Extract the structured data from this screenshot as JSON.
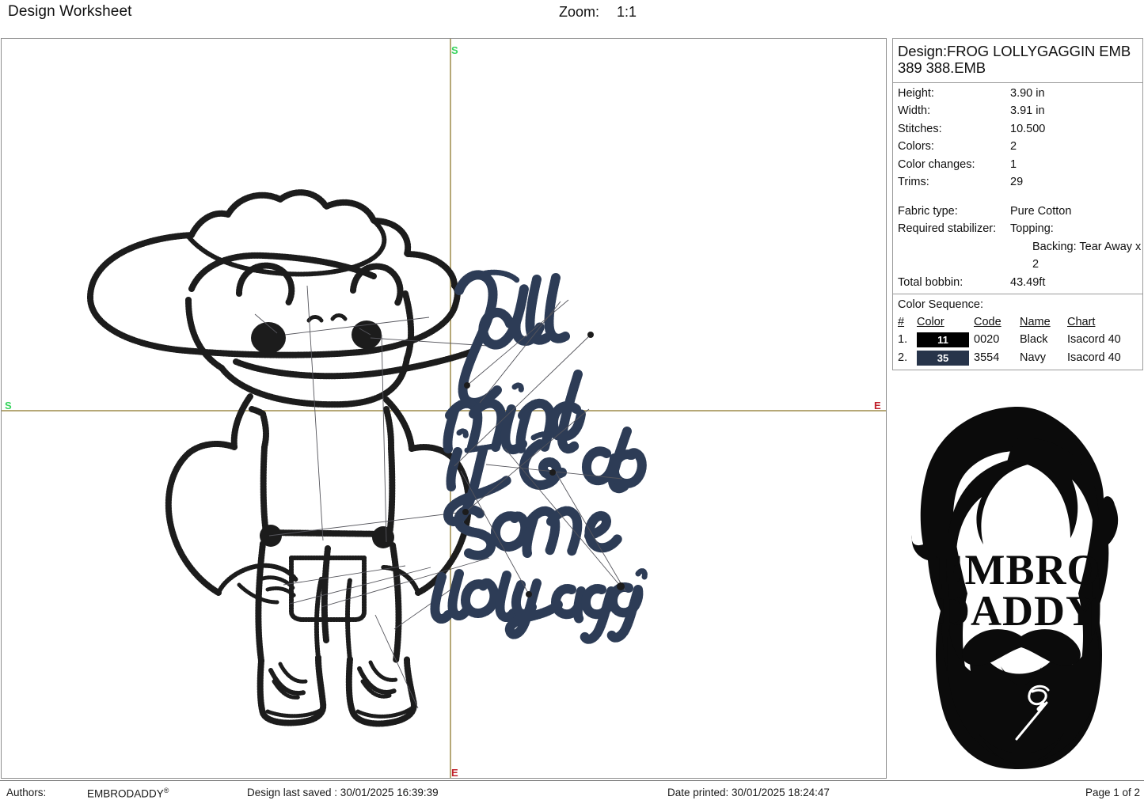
{
  "header": {
    "title": "Design Worksheet",
    "zoom_label": "Zoom:",
    "zoom_value": "1:1"
  },
  "canvas": {
    "axis_markers": {
      "left": "S",
      "right": "E",
      "top": "S",
      "bottom": "E"
    },
    "design_text_lines": [
      "Y'all",
      "mind",
      "if I do",
      "some",
      "lollygaggin'"
    ],
    "artwork_description": "Cowboy frog wearing hat, overalls and boots",
    "colors": {
      "axis_line": "#b6a877",
      "start_marker": "#35d35c",
      "end_marker": "#c0202a",
      "outline_black": "#1c1c1c",
      "script_navy": "#2d3c56"
    }
  },
  "info": {
    "design_title": "Design:FROG LOLLYGAGGIN EMB 389 388.EMB",
    "properties": [
      {
        "label": "Height:",
        "value": "3.90 in"
      },
      {
        "label": "Width:",
        "value": "3.91 in"
      },
      {
        "label": "Stitches:",
        "value": "10.500"
      },
      {
        "label": "Colors:",
        "value": "2"
      },
      {
        "label": "Color changes:",
        "value": "1"
      },
      {
        "label": "Trims:",
        "value": "29"
      }
    ],
    "fabric": [
      {
        "label": "Fabric type:",
        "value": "Pure Cotton"
      },
      {
        "label": "Required stabilizer:",
        "value": "Topping:"
      },
      {
        "label": "",
        "value": "Backing: Tear Away x 2"
      },
      {
        "label": "Total bobbin:",
        "value": "43.49ft"
      }
    ],
    "color_sequence": {
      "heading": "Color Sequence:",
      "columns": [
        "#",
        "Color",
        "Code",
        "Name",
        "Chart"
      ],
      "rows": [
        {
          "num": "1.",
          "swatch_label": "11",
          "swatch_color": "#000000",
          "code": "0020",
          "name": "Black",
          "chart": "Isacord 40"
        },
        {
          "num": "2.",
          "swatch_label": "35",
          "swatch_color": "#27344a",
          "code": "3554",
          "name": "Navy",
          "chart": "Isacord 40"
        }
      ]
    }
  },
  "logo": {
    "line1": "EMBRO",
    "line2": "DADDY",
    "alt": "Bearded man silhouette logo"
  },
  "footer": {
    "authors_label": "Authors:",
    "authors_value": "EMBRODADDY",
    "authors_mark": "®",
    "last_saved": "Design last saved : 30/01/2025 16:39:39",
    "date_printed": "Date printed: 30/01/2025 18:24:47",
    "page": "Page 1 of 2"
  }
}
